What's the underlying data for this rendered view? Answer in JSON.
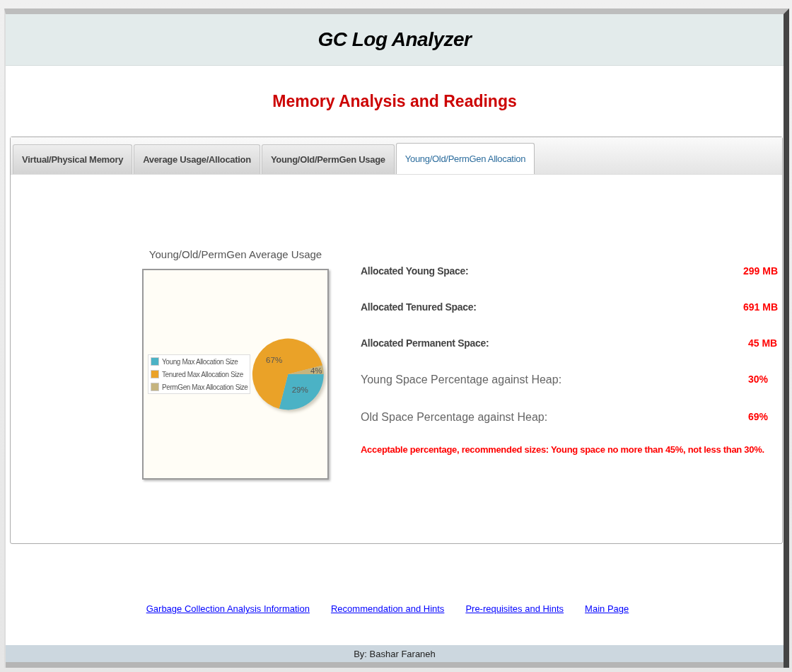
{
  "header": {
    "title": "GC Log Analyzer"
  },
  "subtitle": "Memory Analysis and Readings",
  "tabs": [
    {
      "label": "Virtual/Physical Memory",
      "selected": false
    },
    {
      "label": "Average Usage/Allocation",
      "selected": false
    },
    {
      "label": "Young/Old/PermGen Usage",
      "selected": false
    },
    {
      "label": "Young/Old/PermGen Allocation",
      "selected": true
    }
  ],
  "chart": {
    "chart_data": {
      "type": "pie",
      "title": "Young/Old/PermGen Average Usage",
      "categories": [
        "Young Max Allocation Size",
        "Tenured Max Allocation Size",
        "PermGen Max Allocation Size"
      ],
      "legend": "left",
      "series": [
        {
          "values": [
            29,
            67,
            4
          ]
        }
      ],
      "colors": [
        "#4bb2c5",
        "#eaa228",
        "#c5b47f"
      ],
      "value_labels": [
        "29%",
        "67%",
        "4%"
      ]
    }
  },
  "readings": [
    {
      "kind": "allocation",
      "label": "Allocated Young Space:",
      "value": "299 MB"
    },
    {
      "kind": "allocation",
      "label": "Allocated Tenured Space:",
      "value": "691 MB"
    },
    {
      "kind": "allocation",
      "label": "Allocated Permanent Space:",
      "value": "45 MB"
    },
    {
      "kind": "percentage",
      "label": "Young Space Percentage against Heap:",
      "value": "30%"
    },
    {
      "kind": "percentage",
      "label": "Old Space Percentage against Heap:",
      "value": "69%"
    }
  ],
  "note": "Acceptable percentage, recommended sizes: Young space no more than 45%, not less than 30%.",
  "footer_links": [
    "Garbage Collection Analysis Information",
    "Recommendation and Hints",
    "Pre-requisites and Hints",
    "Main Page"
  ],
  "footer": "By: Bashar Faraneh"
}
